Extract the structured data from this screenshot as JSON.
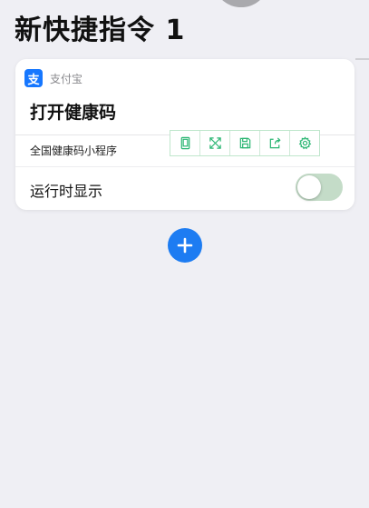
{
  "page": {
    "title": "新快捷指令 1"
  },
  "card": {
    "app_name": "支付宝",
    "app_icon_glyph": "支",
    "action_title": "打开健康码",
    "subtitle": "全国健康码小程序",
    "toggle_label": "运行时显示",
    "toggle_on": false
  },
  "toolbar": {
    "icons": [
      "phone-frame-icon",
      "expand-arrows-icon",
      "save-icon",
      "share-icon",
      "gear-icon"
    ]
  },
  "colors": {
    "accent_blue": "#1d7cf2",
    "alipay_blue": "#1677ff",
    "toolbar_green": "#2bb673",
    "toggle_off": "#c4dcc8",
    "background": "#efeff4"
  }
}
